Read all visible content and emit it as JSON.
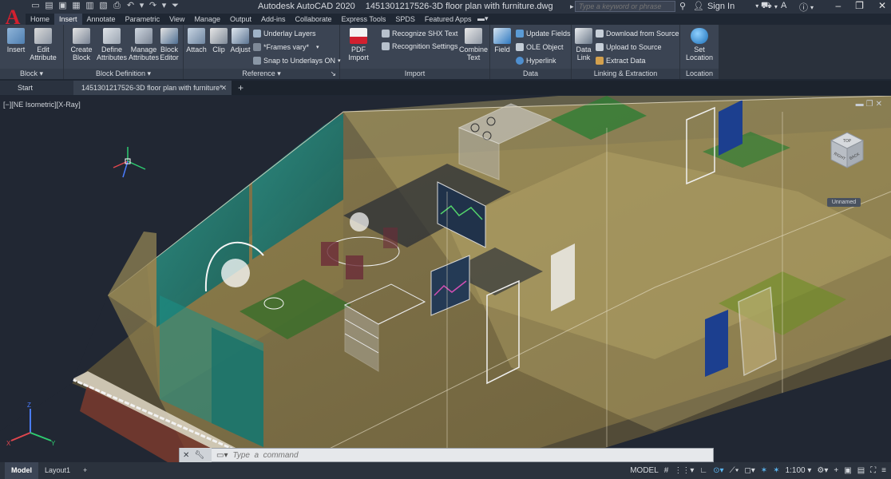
{
  "title_bar": {
    "app_name": "Autodesk AutoCAD 2020",
    "file_name": "1451301217526-3D floor plan with furniture.dwg",
    "search_placeholder": "Type a keyword or phrase",
    "sign_in": "Sign In"
  },
  "ribbon_tabs": [
    "Home",
    "Insert",
    "Annotate",
    "Parametric",
    "View",
    "Manage",
    "Output",
    "Add-ins",
    "Collaborate",
    "Express Tools",
    "SPDS",
    "Featured Apps"
  ],
  "active_tab": "Insert",
  "panels": {
    "block": {
      "title": "Block",
      "insert": "Insert",
      "edit_attribute": "Edit Attribute"
    },
    "block_definition": {
      "title": "Block Definition",
      "create_block": "Create Block",
      "define_attributes": "Define Attributes",
      "manage_attributes": "Manage Attributes",
      "block_editor": "Block Editor"
    },
    "reference": {
      "title": "Reference",
      "attach": "Attach",
      "clip": "Clip",
      "adjust": "Adjust",
      "underlay_layers": "Underlay Layers",
      "frames_vary": "*Frames vary*",
      "snap_to_underlays": "Snap to Underlays ON"
    },
    "import": {
      "title": "Import",
      "pdf_import": "PDF Import",
      "recognize_shx": "Recognize SHX Text",
      "recognition_settings": "Recognition Settings",
      "combine_text": "Combine Text"
    },
    "data": {
      "title": "Data",
      "field": "Field",
      "update_fields": "Update Fields",
      "ole_object": "OLE Object",
      "hyperlink": "Hyperlink"
    },
    "linking": {
      "title": "Linking & Extraction",
      "data_link": "Data Link",
      "download_from_source": "Download from Source",
      "upload_to_source": "Upload to Source",
      "extract_data": "Extract  Data"
    },
    "location": {
      "title": "Location",
      "set_location": "Set Location"
    }
  },
  "file_tabs": {
    "start": "Start",
    "file": "1451301217526-3D floor plan with furniture*"
  },
  "viewport": {
    "label": "[−][NE Isometric][X-Ray]",
    "view_cube_label": "Unnamed",
    "cube_top": "TOP",
    "cube_right": "RIGHT",
    "cube_back": "BACK"
  },
  "command_line": {
    "placeholder": "Type  a  command"
  },
  "status_bar": {
    "model_tab": "Model",
    "layout_tab": "Layout1",
    "model_label": "MODEL",
    "scale": "1:100"
  }
}
